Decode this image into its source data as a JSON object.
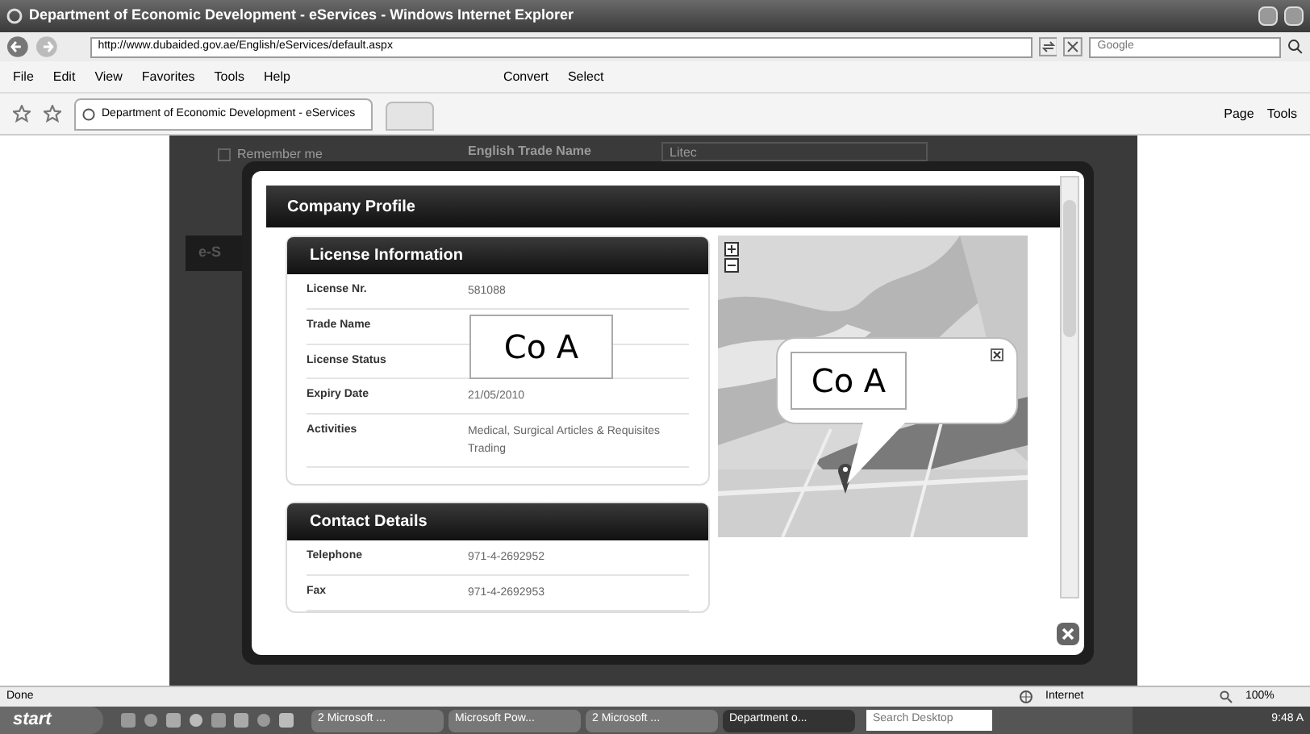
{
  "window": {
    "title": "Department of Economic Development - eServices - Windows Internet Explorer"
  },
  "address_bar": {
    "url": "http://www.dubaided.gov.ae/English/eServices/default.aspx",
    "search_placeholder": "Google"
  },
  "menu": [
    "File",
    "Edit",
    "View",
    "Favorites",
    "Tools",
    "Help"
  ],
  "toolbar": [
    "Convert",
    "Select"
  ],
  "tab": {
    "title": "Department of Economic Development - eServices"
  },
  "command_bar": [
    "Page",
    "Tools"
  ],
  "background_page": {
    "remember_me": {
      "label": "Remember me",
      "checked": false
    },
    "field_label": "English Trade Name",
    "field_value": "Litec",
    "tab_label": "e-S"
  },
  "modal": {
    "title": "Company Profile",
    "license": {
      "title": "License Information",
      "redaction": "Co A",
      "rows": [
        {
          "label": "License Nr.",
          "value": "581088"
        },
        {
          "label": "Trade Name",
          "value": ""
        },
        {
          "label": "License Status",
          "value": ""
        },
        {
          "label": "Expiry Date",
          "value": "21/05/2010"
        },
        {
          "label": "Activities",
          "value": "Medical, Surgical Articles & Requisites Trading"
        }
      ]
    },
    "map": {
      "kind": "picture",
      "callout": "Co A"
    },
    "contact": {
      "title": "Contact Details",
      "rows": [
        {
          "label": "Telephone",
          "value": "971-4-2692952"
        },
        {
          "label": "Fax",
          "value": "971-4-2692953"
        }
      ]
    }
  },
  "status_bar": {
    "text": "Done",
    "zone": "Internet",
    "zoom": "100%"
  },
  "taskbar": {
    "start": "start",
    "tasks": [
      {
        "label": "2 Microsoft ...",
        "selected": false
      },
      {
        "label": "Microsoft Pow...",
        "selected": false
      },
      {
        "label": "2 Microsoft ...",
        "selected": false
      },
      {
        "label": "Department o...",
        "selected": true
      }
    ],
    "search_placeholder": "Search Desktop",
    "clock": "9:48 A"
  }
}
